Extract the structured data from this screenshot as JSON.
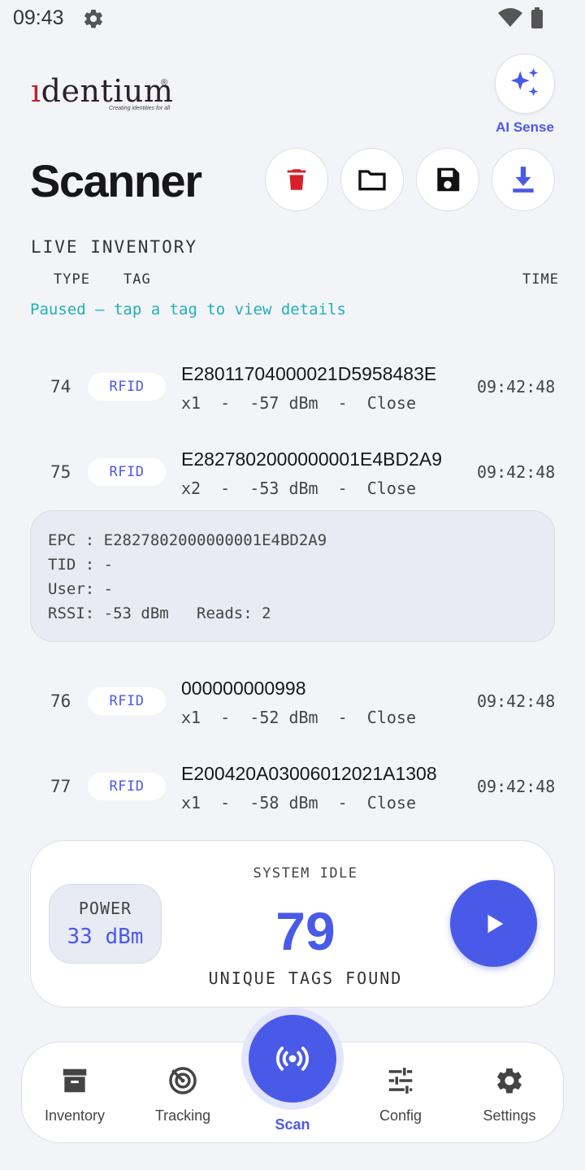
{
  "status_bar": {
    "time": "09:43"
  },
  "brand": {
    "name_prefix": "ı",
    "name_rest": "dentium",
    "registered": "®",
    "tagline": "Creating identities for all"
  },
  "ai_sense": {
    "label": "AI Sense"
  },
  "header": {
    "title": "Scanner"
  },
  "inventory": {
    "section_label": "LIVE INVENTORY",
    "columns": {
      "type": "TYPE",
      "tag": "TAG",
      "time": "TIME"
    },
    "status_message": "Paused — tap a tag to view details",
    "rows": [
      {
        "num": "74",
        "type": "RFID",
        "tag": "E28011704000021D5958483E",
        "sub": "x1  -  -57 dBm  -  Close",
        "time": "09:42:48"
      },
      {
        "num": "75",
        "type": "RFID",
        "tag": "E2827802000000001E4BD2A9",
        "sub": "x2  -  -53 dBm  -  Close",
        "time": "09:42:48"
      },
      {
        "num": "76",
        "type": "RFID",
        "tag": "000000000998",
        "sub": "x1  -  -52 dBm  -  Close",
        "time": "09:42:48"
      },
      {
        "num": "77",
        "type": "RFID",
        "tag": "E200420A03006012021A1308",
        "sub": "x1  -  -58 dBm  -  Close",
        "time": "09:42:48"
      }
    ],
    "details": {
      "epc": "EPC : E2827802000000001E4BD2A9",
      "tid": "TID : -",
      "user": "User: -",
      "rssi": "RSSI: -53 dBm   Reads: 2"
    }
  },
  "stats": {
    "power_label": "POWER",
    "power_value": "33 dBm",
    "system_state": "SYSTEM IDLE",
    "unique_count": "79",
    "unique_label": "UNIQUE TAGS FOUND"
  },
  "nav": {
    "inventory": "Inventory",
    "tracking": "Tracking",
    "scan": "Scan",
    "config": "Config",
    "settings": "Settings"
  },
  "colors": {
    "accent": "#4a5ae8",
    "danger": "#d8202c",
    "teal": "#1fb0b8"
  },
  "icons": {
    "status": [
      "gear-icon",
      "wifi-icon",
      "battery-icon"
    ],
    "toolbar": [
      "trash-icon",
      "folder-icon",
      "save-icon",
      "download-icon"
    ],
    "ai": "sparkles-icon",
    "play": "play-icon",
    "nav": [
      "archive-icon",
      "radar-icon",
      "broadcast-icon",
      "sliders-icon",
      "gear-icon"
    ]
  }
}
